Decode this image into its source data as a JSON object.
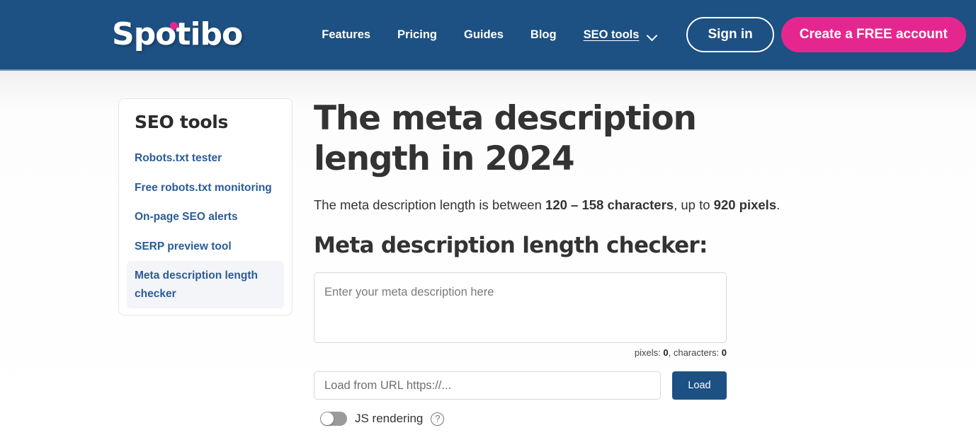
{
  "header": {
    "logo_text": "Spotibo",
    "nav": [
      {
        "label": "Features",
        "underlined": false
      },
      {
        "label": "Pricing",
        "underlined": false
      },
      {
        "label": "Guides",
        "underlined": false
      },
      {
        "label": "Blog",
        "underlined": false
      }
    ],
    "dropdown": {
      "label": "SEO tools",
      "icon": "chevron-down-icon"
    },
    "signin_label": "Sign in",
    "create_account_label": "Create a FREE account",
    "background_color": "#1d5083",
    "accent_pink": "#e6268f"
  },
  "sidebar": {
    "title": "SEO tools",
    "items": [
      {
        "label": "Robots.txt tester",
        "active": false
      },
      {
        "label": "Free robots.txt monitoring",
        "active": false
      },
      {
        "label": "On-page SEO alerts",
        "active": false
      },
      {
        "label": "SERP preview tool",
        "active": false
      },
      {
        "label": "Meta description length checker",
        "active": true
      }
    ],
    "link_color": "#2a5c96",
    "active_background": "#f4f5f8"
  },
  "main": {
    "page_title": "The meta description length in 2024",
    "lede": {
      "part1": "The meta description length is between ",
      "bold1": "120 – 158 characters",
      "part2": ", up to ",
      "bold2": "920 pixels",
      "part3": "."
    },
    "section_title": "Meta description length checker:",
    "textarea": {
      "placeholder": "Enter your meta description here",
      "value": ""
    },
    "counter": {
      "pixels_label": "pixels: ",
      "pixels_value": "0",
      "chars_label": ", characters: ",
      "chars_value": "0"
    },
    "url_input": {
      "placeholder": "Load from URL https://...",
      "value": ""
    },
    "load_button_label": "Load",
    "js_rendering": {
      "label": "JS rendering",
      "enabled": false,
      "help_icon_glyph": "?"
    }
  }
}
